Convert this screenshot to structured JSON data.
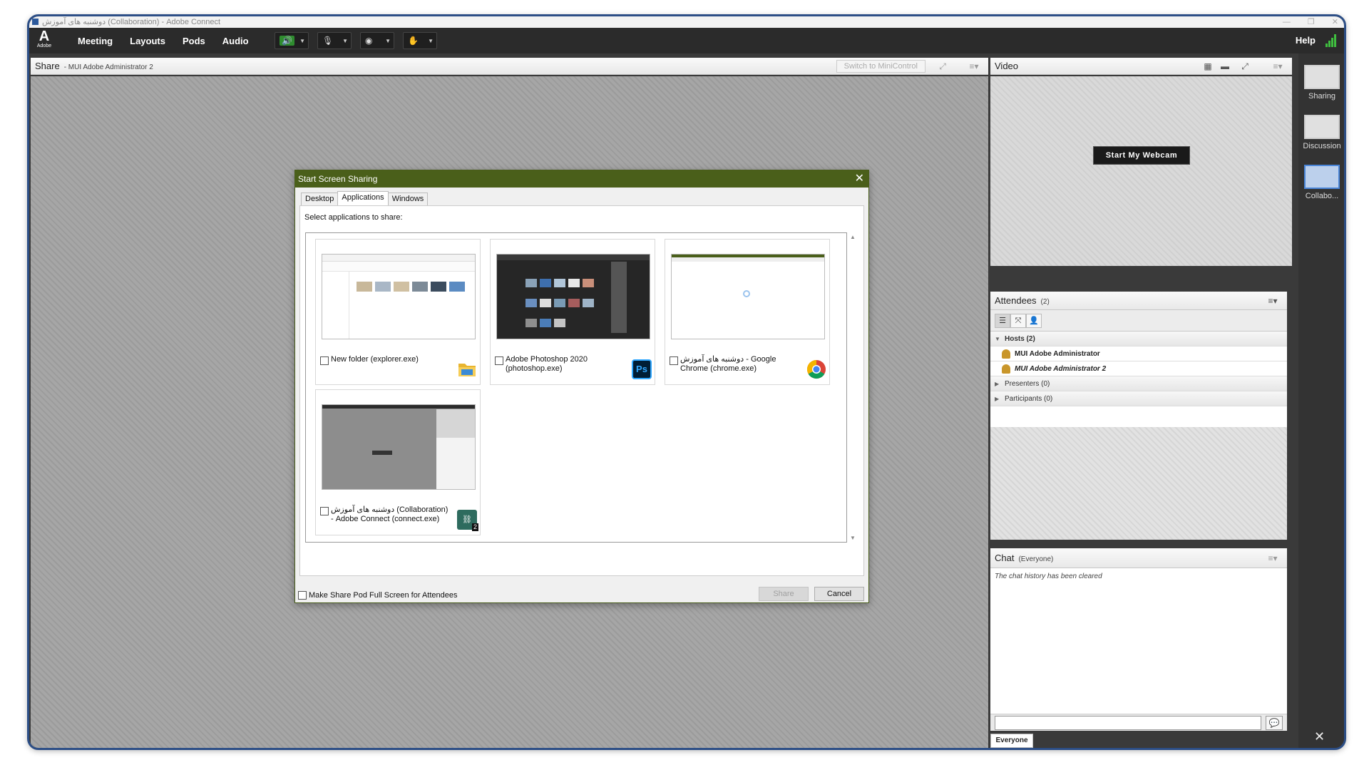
{
  "window": {
    "title": "دوشنبه های آموزش (Collaboration) - Adobe Connect",
    "controls": [
      "—",
      "❐",
      "✕"
    ]
  },
  "menubar": {
    "logo": "A",
    "logo_text": "Adobe",
    "items": [
      "Meeting",
      "Layouts",
      "Pods",
      "Audio"
    ],
    "help": "Help",
    "accent": "#2f8c2f",
    "tools": [
      "speaker-icon",
      "microphone-icon",
      "webcam-icon",
      "raise-hand-icon"
    ]
  },
  "share_pod": {
    "title": "Share",
    "subtitle": "- MUI Adobe Administrator 2",
    "mini_control": "Switch to MiniControl"
  },
  "dialog": {
    "title": "Start Screen Sharing",
    "close": "✕",
    "tabs": [
      "Desktop",
      "Applications",
      "Windows"
    ],
    "selected_tab": "Applications",
    "prompt": "Select applications to share:",
    "apps": [
      {
        "label": "New folder (explorer.exe)",
        "icon": "folder-icon"
      },
      {
        "label": "Adobe Photoshop 2020 (photoshop.exe)",
        "icon": "photoshop-icon",
        "icon_text": "Ps"
      },
      {
        "label": "دوشنبه های آموزش - Google Chrome (chrome.exe)",
        "icon": "chrome-icon"
      },
      {
        "label": "دوشنبه های آموزش (Collaboration) - Adobe Connect (connect.exe)",
        "icon": "connect-icon",
        "badge": "2"
      }
    ],
    "fullscreen_option": "Make Share Pod Full Screen for Attendees",
    "share_button": "Share",
    "cancel_button": "Cancel",
    "title_color": "#4a5f1a"
  },
  "video_pod": {
    "title": "Video",
    "start_webcam": "Start My Webcam"
  },
  "layouts": [
    {
      "label": "Sharing"
    },
    {
      "label": "Discussion"
    },
    {
      "label": "Collabo..."
    }
  ],
  "attendees": {
    "title": "Attendees",
    "count": "(2)",
    "groups": {
      "hosts": "Hosts (2)",
      "presenters": "Presenters (0)",
      "participants": "Participants (0)"
    },
    "hosts": [
      "MUI Adobe Administrator",
      "MUI Adobe Administrator 2"
    ]
  },
  "chat": {
    "title": "Chat",
    "scope": "(Everyone)",
    "message": "The chat history has been cleared",
    "input_placeholder": "",
    "tab": "Everyone"
  }
}
